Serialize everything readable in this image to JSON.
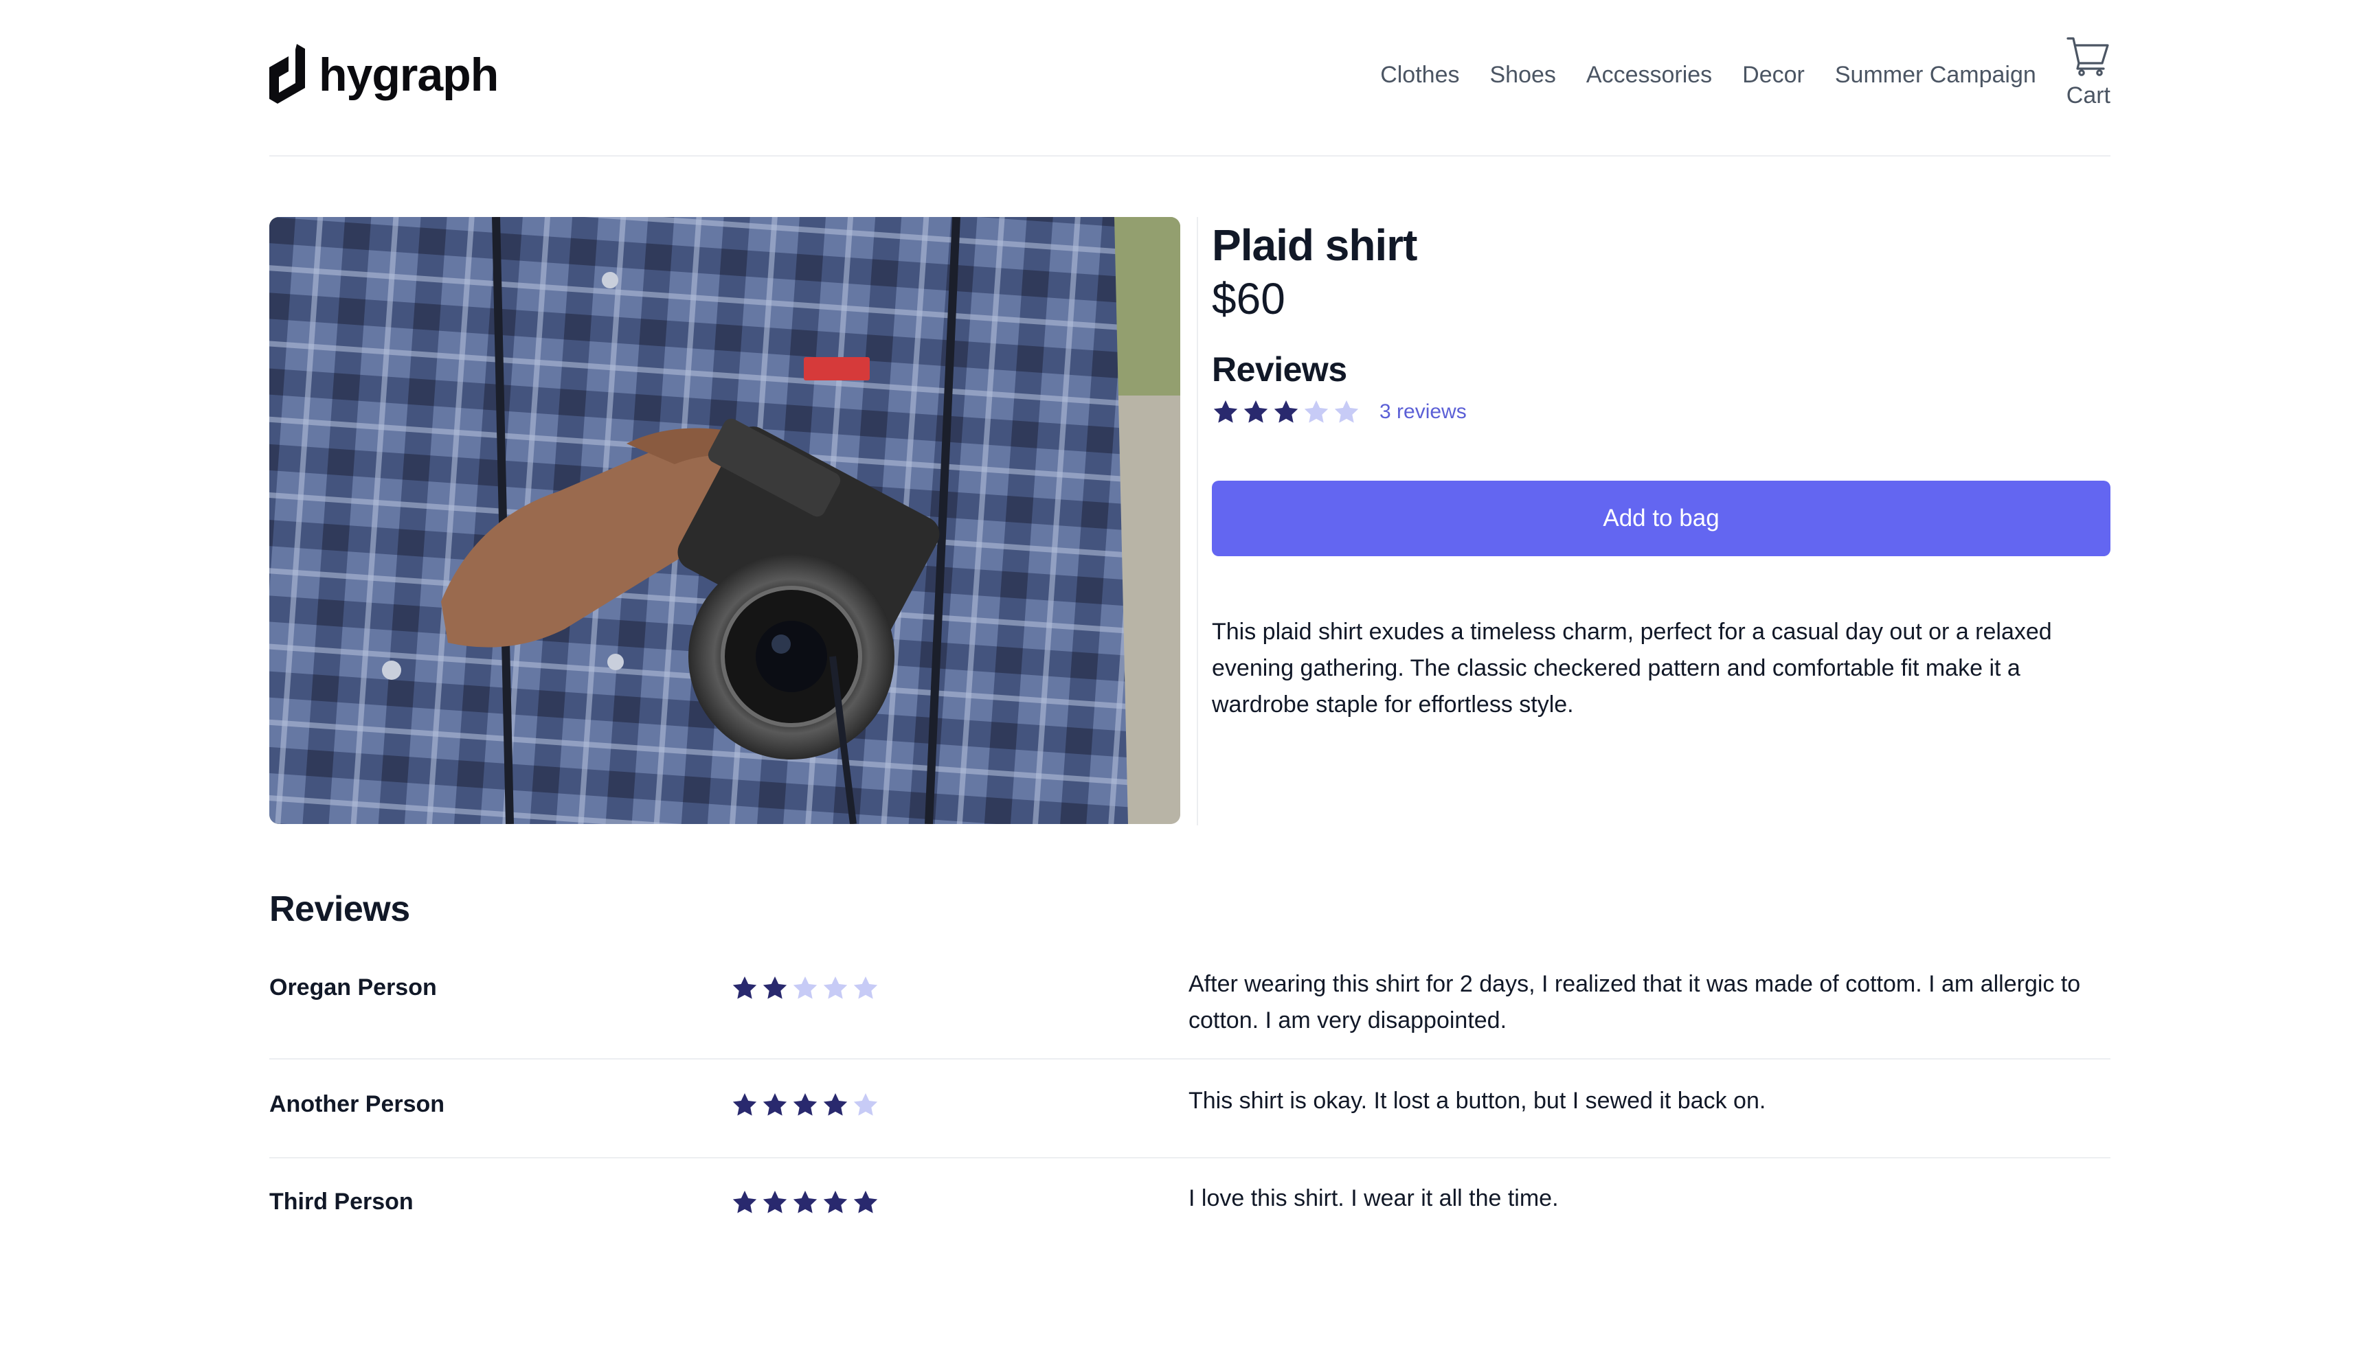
{
  "brand": {
    "name": "hygraph"
  },
  "nav": {
    "items": [
      {
        "label": "Clothes"
      },
      {
        "label": "Shoes"
      },
      {
        "label": "Accessories"
      },
      {
        "label": "Decor"
      },
      {
        "label": "Summer Campaign"
      }
    ],
    "cart_label": "Cart",
    "cart_icon": "cart-icon"
  },
  "product": {
    "title": "Plaid shirt",
    "price": "$60",
    "reviews_heading": "Reviews",
    "rating": 3,
    "rating_max": 5,
    "reviews_link": "3 reviews",
    "add_to_bag": "Add to bag",
    "description": "This plaid shirt exudes a timeless charm, perfect for a casual day out or a relaxed evening gathering. The classic checkered pattern and comfortable fit make it a wardrobe staple for effortless style.",
    "image_alt": "Person in plaid shirt holding a camera"
  },
  "reviews": {
    "heading": "Reviews",
    "items": [
      {
        "name": "Oregan Person",
        "rating": 2,
        "text": "After wearing this shirt for 2 days, I realized that it was made of cottom. I am allergic to cotton. I am very disappointed."
      },
      {
        "name": "Another Person",
        "rating": 4,
        "text": "This shirt is okay. It lost a button, but I sewed it back on."
      },
      {
        "name": "Third Person",
        "rating": 5,
        "text": "I love this shirt. I wear it all the time."
      }
    ]
  },
  "colors": {
    "accent": "#6366f1",
    "star_filled": "#29296e",
    "star_empty": "#c7cbf6",
    "link": "#5b5fd6"
  }
}
